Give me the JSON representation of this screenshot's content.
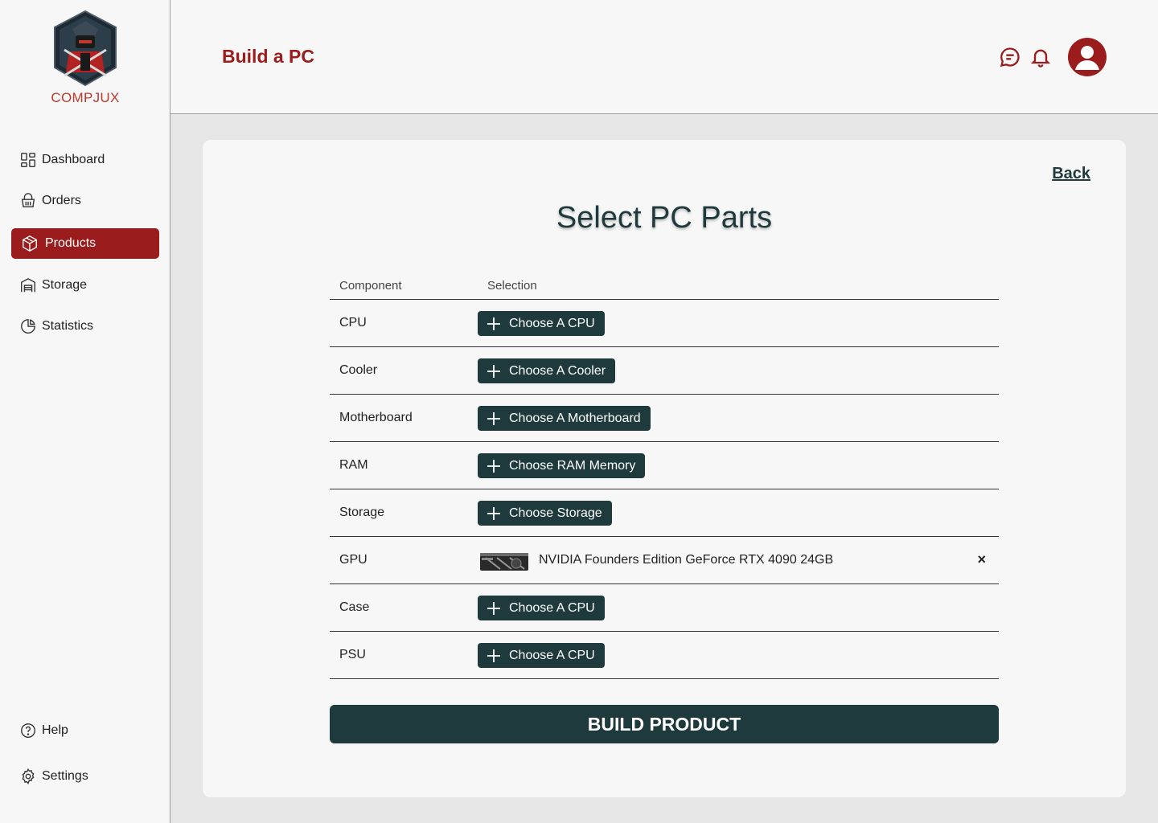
{
  "brand": {
    "name": "COMPJUX"
  },
  "sidebar": {
    "items": [
      {
        "label": "Dashboard",
        "icon": "dashboard-icon"
      },
      {
        "label": "Orders",
        "icon": "basket-icon"
      },
      {
        "label": "Products",
        "icon": "box-icon",
        "active": true
      },
      {
        "label": "Storage",
        "icon": "warehouse-icon"
      },
      {
        "label": "Statistics",
        "icon": "pie-chart-icon"
      }
    ],
    "bottom_items": [
      {
        "label": "Help",
        "icon": "help-icon"
      },
      {
        "label": "Settings",
        "icon": "gear-icon"
      }
    ]
  },
  "header": {
    "title": "Build a PC",
    "icons": [
      "chat-icon",
      "bell-icon",
      "user-avatar-icon"
    ]
  },
  "card": {
    "back_label": "Back",
    "title": "Select PC Parts",
    "columns": {
      "component": "Component",
      "selection": "Selection"
    },
    "rows": [
      {
        "component": "CPU",
        "button": "Choose A CPU"
      },
      {
        "component": "Cooler",
        "button": "Choose A Cooler"
      },
      {
        "component": "Motherboard",
        "button": "Choose A Motherboard"
      },
      {
        "component": "RAM",
        "button": "Choose RAM Memory"
      },
      {
        "component": "Storage",
        "button": "Choose Storage"
      },
      {
        "component": "GPU",
        "selected": "NVIDIA Founders Edition GeForce RTX 4090 24GB",
        "remove": "×"
      },
      {
        "component": "Case",
        "button": "Choose A CPU"
      },
      {
        "component": "PSU",
        "button": "Choose A CPU"
      }
    ],
    "build_label": "BUILD PRODUCT"
  },
  "colors": {
    "brand_red": "#9b1c1c",
    "dark_teal": "#1f3a3d",
    "logo_text": "#c0392b"
  }
}
